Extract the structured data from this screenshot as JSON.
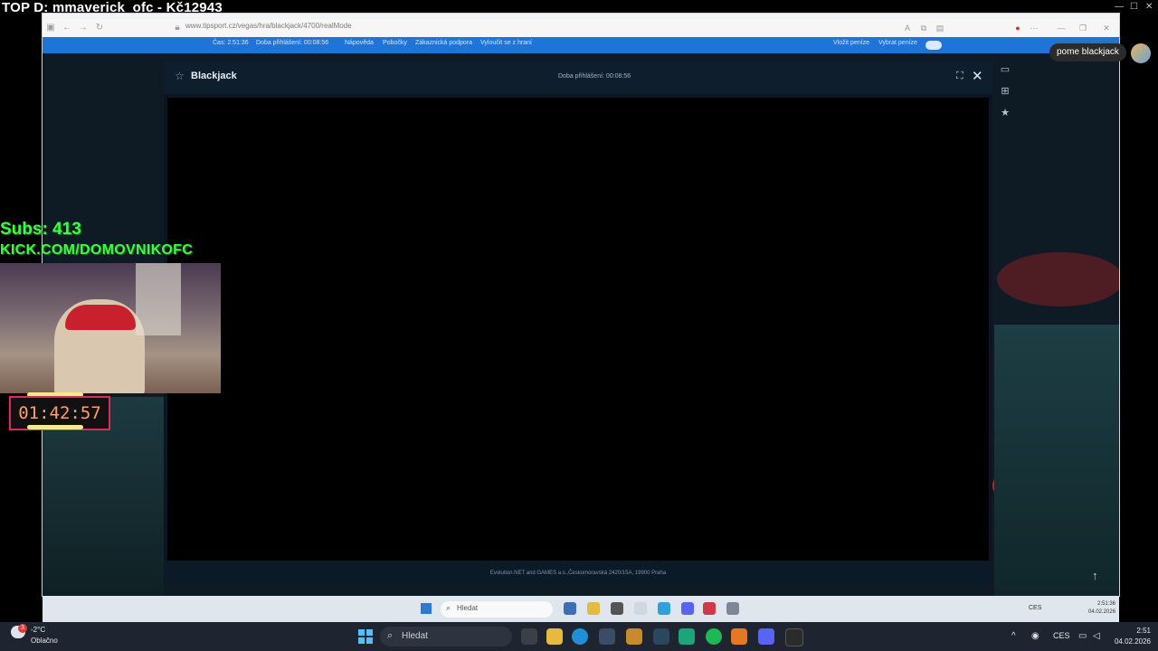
{
  "overlay": {
    "top_donor": "TOP D: mmaverick_ofc - Kč12943",
    "subs": "Subs: 413",
    "channel": "KICK.COM/DOMOVNIKOFC",
    "timer": "01:42:57"
  },
  "browser": {
    "url": "www.tipsport.cz/vegas/hra/blackjack/4700/realMode",
    "site_nav": {
      "time": "Čas: 2:51:36",
      "login_time": "Doba přihlášení: 00:08:56",
      "links": [
        "Nápověda",
        "Pobočky",
        "Zákaznická podpora",
        "Vyloučit se z hraní"
      ],
      "deposit": "Vložit peníze",
      "withdraw": "Vybrat peníze"
    }
  },
  "modal": {
    "title": "Blackjack",
    "session": "Doba přihlášení: 00:08:56",
    "footer": "Evolution.NET and GAMES a.s.,Českomoravská 2420/15A, 19900 Praha"
  },
  "tooltip": {
    "text": "pome blackjack"
  },
  "inner_taskbar": {
    "search": "Hledat",
    "lang": "CES",
    "time": "2:51:36",
    "date": "04.02.2026"
  },
  "taskbar": {
    "weather_temp": "-2°C",
    "weather_desc": "Oblačno",
    "weather_badge": "3",
    "search": "Hledat",
    "lang": "CES",
    "time": "2:51",
    "date": "04.02.2026"
  },
  "icons": {
    "accent": "#1e74d9",
    "overlay_green": "#37ff3e",
    "timer_border": "#e02a55"
  }
}
